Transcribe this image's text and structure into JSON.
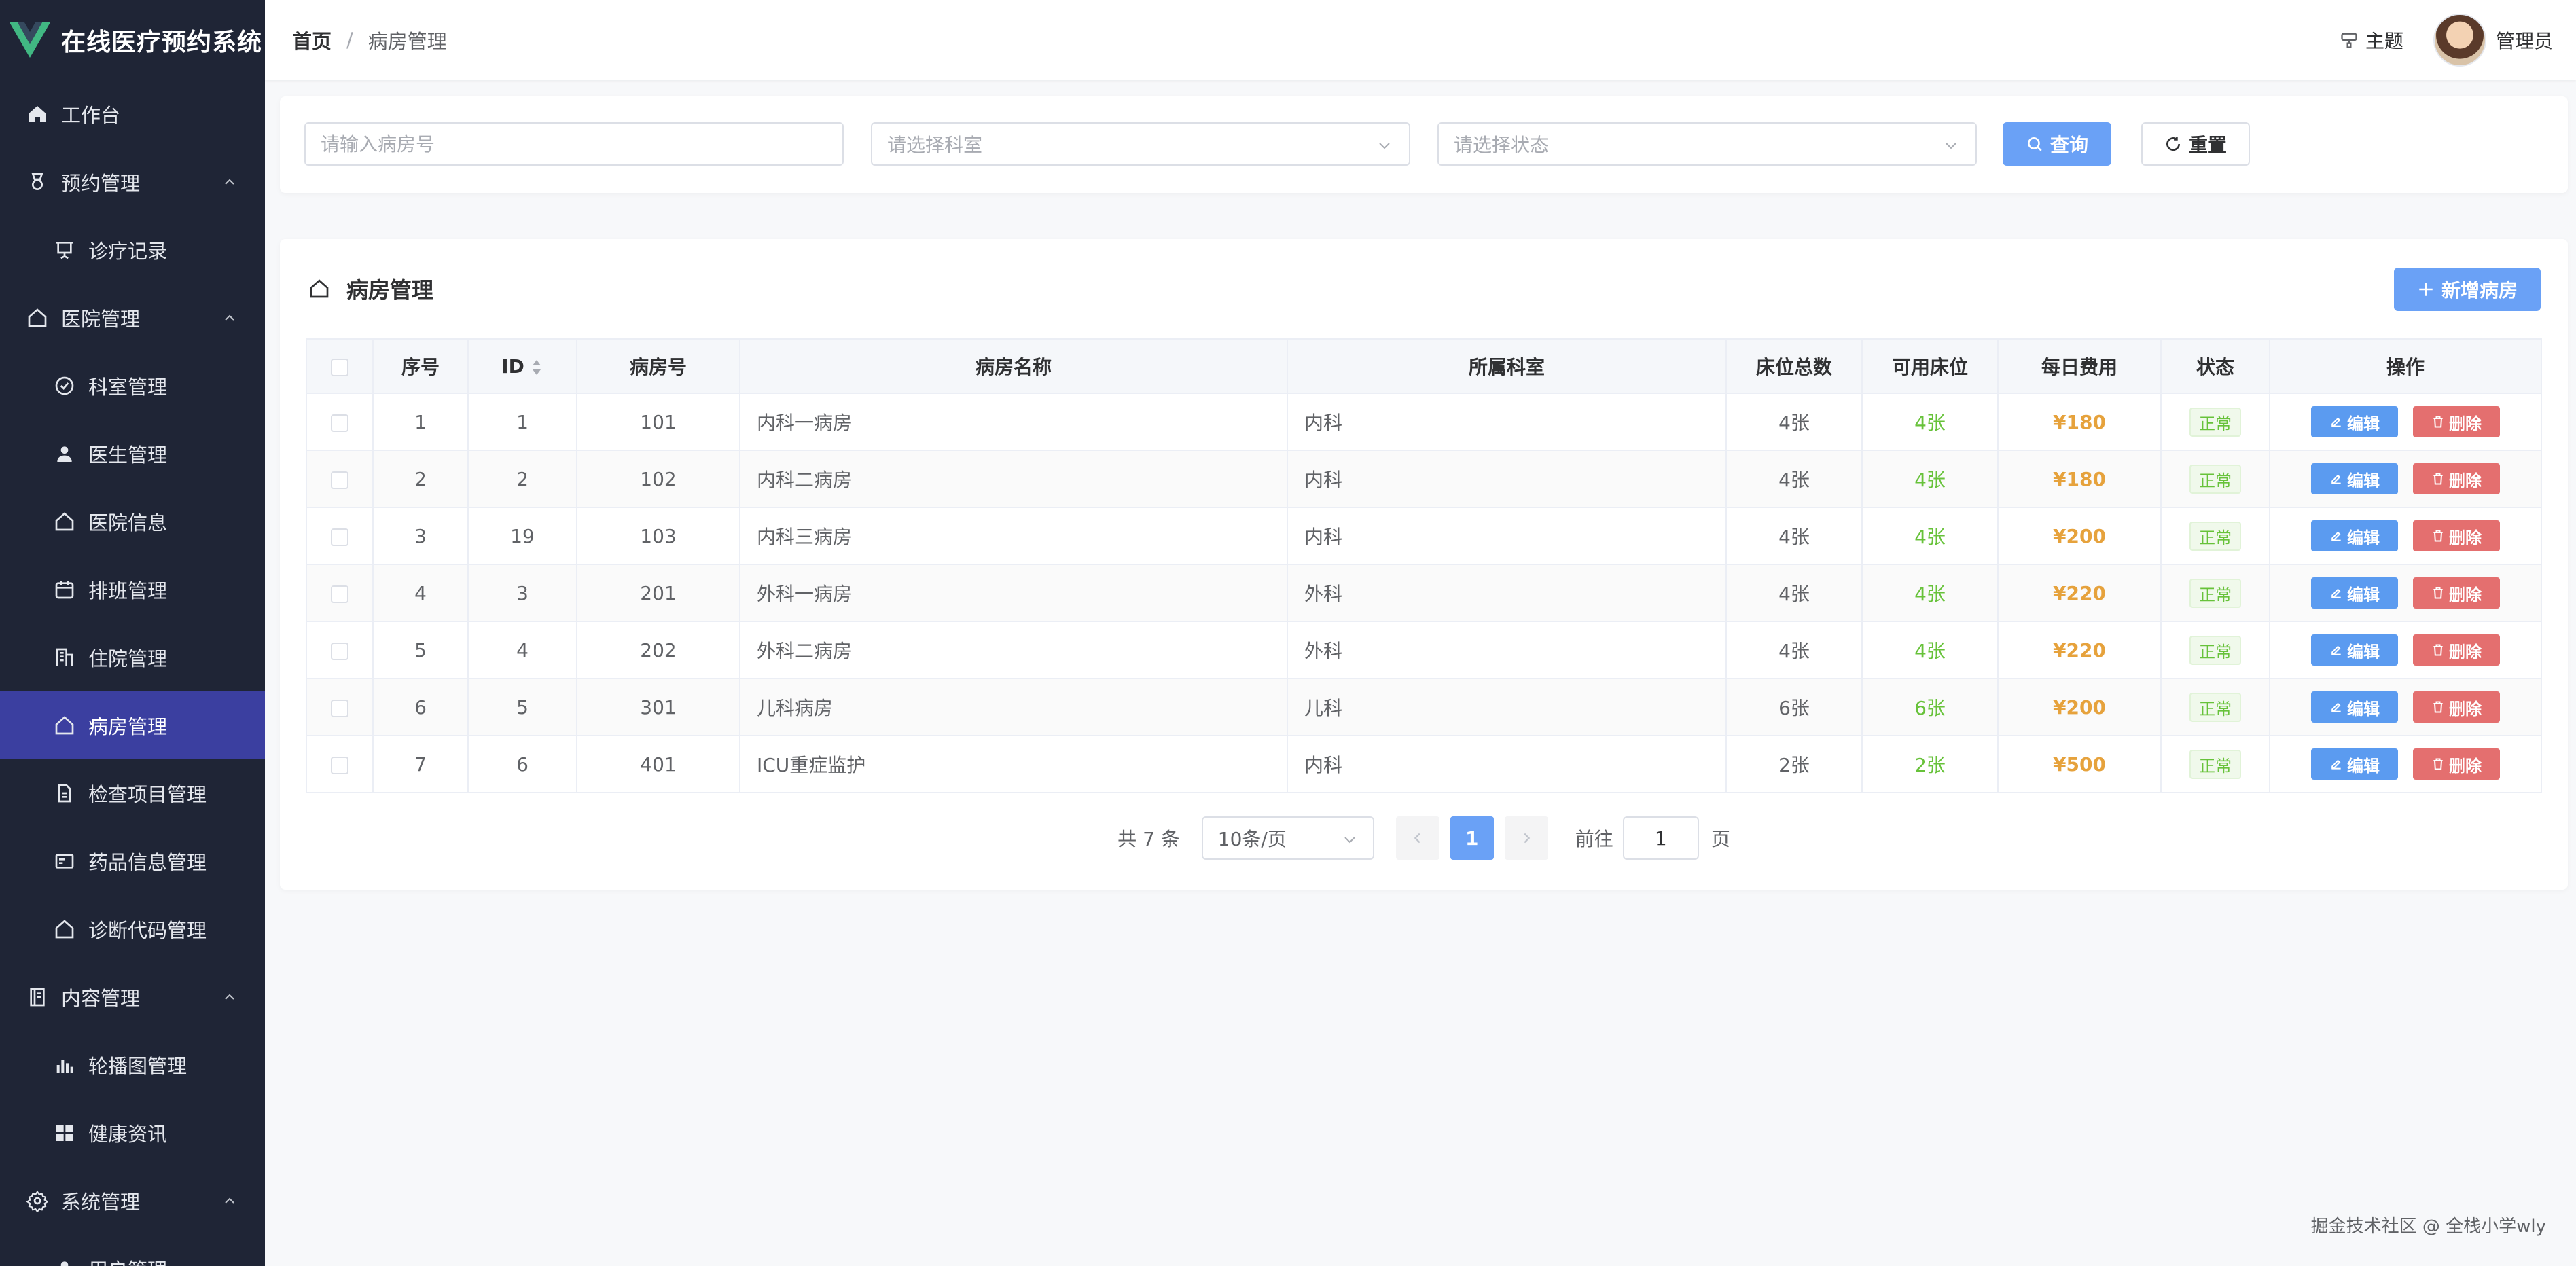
{
  "app": {
    "title": "在线医疗预约系统",
    "brand_color": "#3b3fa0"
  },
  "sidebar": {
    "items": [
      {
        "label": "工作台",
        "icon": "home-icon",
        "level": "top"
      },
      {
        "label": "预约管理",
        "icon": "medal-icon",
        "level": "top",
        "expanded": true
      },
      {
        "label": "诊疗记录",
        "icon": "presentation-icon",
        "level": "sub"
      },
      {
        "label": "医院管理",
        "icon": "house-icon",
        "level": "top",
        "expanded": true
      },
      {
        "label": "科室管理",
        "icon": "circle-check-icon",
        "level": "sub"
      },
      {
        "label": "医生管理",
        "icon": "user-icon",
        "level": "sub"
      },
      {
        "label": "医院信息",
        "icon": "house-icon",
        "level": "sub"
      },
      {
        "label": "排班管理",
        "icon": "calendar-icon",
        "level": "sub"
      },
      {
        "label": "住院管理",
        "icon": "office-building-icon",
        "level": "sub"
      },
      {
        "label": "病房管理",
        "icon": "house-icon",
        "level": "sub",
        "active": true
      },
      {
        "label": "检查项目管理",
        "icon": "document-icon",
        "level": "sub"
      },
      {
        "label": "药品信息管理",
        "icon": "postcard-icon",
        "level": "sub"
      },
      {
        "label": "诊断代码管理",
        "icon": "house-icon",
        "level": "sub"
      },
      {
        "label": "内容管理",
        "icon": "notebook-icon",
        "level": "top",
        "expanded": true
      },
      {
        "label": "轮播图管理",
        "icon": "histogram-icon",
        "level": "sub"
      },
      {
        "label": "健康资讯",
        "icon": "grid-icon",
        "level": "sub"
      },
      {
        "label": "系统管理",
        "icon": "gear-icon",
        "level": "top",
        "expanded": true
      },
      {
        "label": "用户管理",
        "icon": "user-icon",
        "level": "sub"
      }
    ]
  },
  "header": {
    "breadcrumb_home": "首页",
    "breadcrumb_sep": "/",
    "breadcrumb_current": "病房管理",
    "theme_label": "主题",
    "user_name": "管理员"
  },
  "search": {
    "room_placeholder": "请输入病房号",
    "dept_placeholder": "请选择科室",
    "status_placeholder": "请选择状态",
    "query_label": "查询",
    "reset_label": "重置"
  },
  "card": {
    "title": "病房管理",
    "add_label": "新增病房"
  },
  "table": {
    "headers": [
      "序号",
      "ID",
      "病房号",
      "病房名称",
      "所属科室",
      "床位总数",
      "可用床位",
      "每日费用",
      "状态",
      "操作"
    ],
    "edit_label": "编辑",
    "delete_label": "删除",
    "rows": [
      {
        "seq": "1",
        "id": "1",
        "room": "101",
        "name": "内科一病房",
        "dept": "内科",
        "total": "4张",
        "avail": "4张",
        "fee": "¥180",
        "status": "正常"
      },
      {
        "seq": "2",
        "id": "2",
        "room": "102",
        "name": "内科二病房",
        "dept": "内科",
        "total": "4张",
        "avail": "4张",
        "fee": "¥180",
        "status": "正常"
      },
      {
        "seq": "3",
        "id": "19",
        "room": "103",
        "name": "内科三病房",
        "dept": "内科",
        "total": "4张",
        "avail": "4张",
        "fee": "¥200",
        "status": "正常"
      },
      {
        "seq": "4",
        "id": "3",
        "room": "201",
        "name": "外科一病房",
        "dept": "外科",
        "total": "4张",
        "avail": "4张",
        "fee": "¥220",
        "status": "正常"
      },
      {
        "seq": "5",
        "id": "4",
        "room": "202",
        "name": "外科二病房",
        "dept": "外科",
        "total": "4张",
        "avail": "4张",
        "fee": "¥220",
        "status": "正常"
      },
      {
        "seq": "6",
        "id": "5",
        "room": "301",
        "name": "儿科病房",
        "dept": "儿科",
        "total": "6张",
        "avail": "6张",
        "fee": "¥200",
        "status": "正常"
      },
      {
        "seq": "7",
        "id": "6",
        "room": "401",
        "name": "ICU重症监护",
        "dept": "内科",
        "total": "2张",
        "avail": "2张",
        "fee": "¥500",
        "status": "正常"
      }
    ]
  },
  "pagination": {
    "total_text": "共 7 条",
    "page_size": "10条/页",
    "current_page": "1",
    "goto_label": "前往",
    "goto_value": "1",
    "page_suffix": "页"
  },
  "watermark": "掘金技术社区 @ 全栈小学wly"
}
